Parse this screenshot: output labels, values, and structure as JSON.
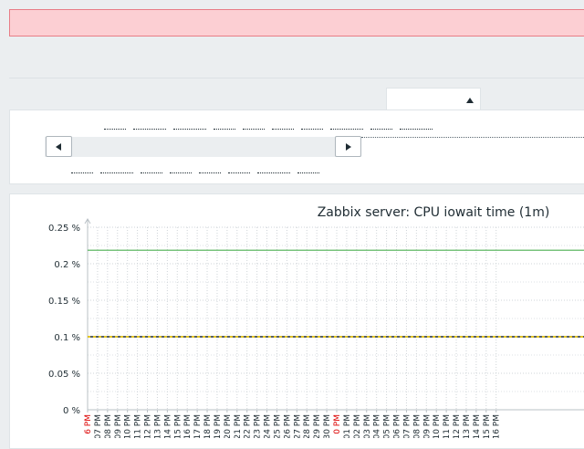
{
  "error_banner": {
    "text": ""
  },
  "filter": {
    "tab_label": "",
    "zoom_links": [
      "",
      "",
      "",
      "",
      "",
      "",
      "",
      "",
      "",
      ""
    ],
    "period_links": [
      "",
      "",
      "",
      "",
      "",
      "",
      "",
      ""
    ]
  },
  "slider": {
    "prev_icon": "triangle-left-icon",
    "next_icon": "triangle-right-icon"
  },
  "colors": {
    "error_bg": "#fccfd3",
    "series_green": "#4caf50",
    "trigger_line": "#1f2c33",
    "trigger_dash": "#ffd500",
    "time_label_normal": "#1f2c33",
    "time_label_highlight": "#dc0000"
  },
  "chart_data": {
    "type": "line",
    "title": "Zabbix server: CPU iowait time (1m)",
    "ylim": [
      0,
      0.25
    ],
    "y_ticks": [
      "0 %",
      "0.05 %",
      "0.1 %",
      "0.15 %",
      "0.2 %",
      "0.25 %"
    ],
    "grid": true,
    "x_tick_labels": [
      {
        "text": "6 PM",
        "highlight": true
      },
      {
        "text": "07 PM",
        "highlight": false
      },
      {
        "text": "08 PM",
        "highlight": false
      },
      {
        "text": "09 PM",
        "highlight": false
      },
      {
        "text": "10 PM",
        "highlight": false
      },
      {
        "text": "11 PM",
        "highlight": false
      },
      {
        "text": "12 PM",
        "highlight": false
      },
      {
        "text": "13 PM",
        "highlight": false
      },
      {
        "text": "14 PM",
        "highlight": false
      },
      {
        "text": "15 PM",
        "highlight": false
      },
      {
        "text": "16 PM",
        "highlight": false
      },
      {
        "text": "17 PM",
        "highlight": false
      },
      {
        "text": "18 PM",
        "highlight": false
      },
      {
        "text": "19 PM",
        "highlight": false
      },
      {
        "text": "20 PM",
        "highlight": false
      },
      {
        "text": "21 PM",
        "highlight": false
      },
      {
        "text": "22 PM",
        "highlight": false
      },
      {
        "text": "23 PM",
        "highlight": false
      },
      {
        "text": "24 PM",
        "highlight": false
      },
      {
        "text": "25 PM",
        "highlight": false
      },
      {
        "text": "26 PM",
        "highlight": false
      },
      {
        "text": "27 PM",
        "highlight": false
      },
      {
        "text": "28 PM",
        "highlight": false
      },
      {
        "text": "29 PM",
        "highlight": false
      },
      {
        "text": "30 PM",
        "highlight": false
      },
      {
        "text": "0 PM",
        "highlight": true
      },
      {
        "text": "01 PM",
        "highlight": false
      },
      {
        "text": "02 PM",
        "highlight": false
      },
      {
        "text": "03 PM",
        "highlight": false
      },
      {
        "text": "04 PM",
        "highlight": false
      },
      {
        "text": "05 PM",
        "highlight": false
      },
      {
        "text": "06 PM",
        "highlight": false
      },
      {
        "text": "07 PM",
        "highlight": false
      },
      {
        "text": "08 PM",
        "highlight": false
      },
      {
        "text": "09 PM",
        "highlight": false
      },
      {
        "text": "10 PM",
        "highlight": false
      },
      {
        "text": "11 PM",
        "highlight": false
      },
      {
        "text": "12 PM",
        "highlight": false
      },
      {
        "text": "13 PM",
        "highlight": false
      },
      {
        "text": "14 PM",
        "highlight": false
      },
      {
        "text": "15 PM",
        "highlight": false
      },
      {
        "text": "16 PM",
        "highlight": false
      }
    ],
    "series": [
      {
        "values": [
          0.2185,
          0.2185
        ]
      }
    ],
    "trigger_value": 0.1
  }
}
